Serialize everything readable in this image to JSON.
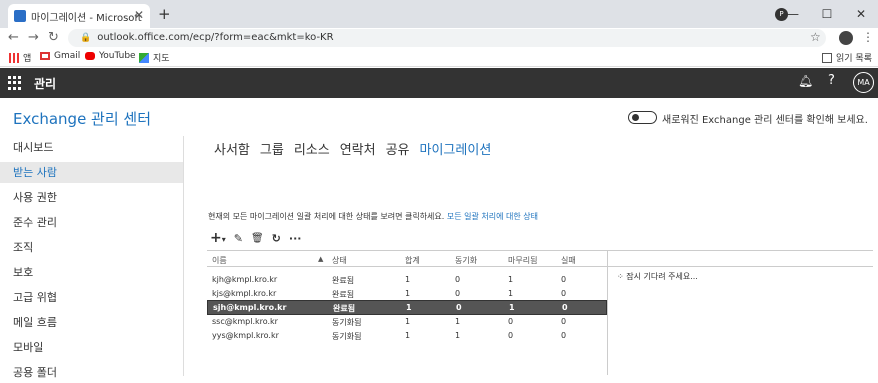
{
  "browser": {
    "tab_title": "마이그레이션 - Microsoft Exchange",
    "url": "outlook.office.com/ecp/?form=eac&mkt=ko-KR",
    "bookmarks": [
      "앱",
      "Gmail",
      "YouTube",
      "지도"
    ],
    "reading_list": "읽기 목록",
    "profile_letter": "P"
  },
  "topbar": {
    "app_name": "관리",
    "help": "?",
    "avatar": "MA"
  },
  "header": {
    "title": "Exchange 관리 센터",
    "toggle_text": "새로워진 Exchange 관리 센터를 확인해 보세요."
  },
  "sidebar": {
    "items": [
      {
        "label": "대시보드"
      },
      {
        "label": "받는 사람",
        "selected": true
      },
      {
        "label": "사용 권한"
      },
      {
        "label": "준수 관리"
      },
      {
        "label": "조직"
      },
      {
        "label": "보호"
      },
      {
        "label": "고급 위협"
      },
      {
        "label": "메일 흐름"
      },
      {
        "label": "모바일"
      },
      {
        "label": "공용 폴더"
      }
    ]
  },
  "tabs": [
    {
      "label": "사서함"
    },
    {
      "label": "그룹"
    },
    {
      "label": "리소스"
    },
    {
      "label": "연락처"
    },
    {
      "label": "공유"
    },
    {
      "label": "마이그레이션",
      "active": true
    }
  ],
  "info": {
    "text": "현재의 모든 마이그레이션 일괄 처리에 대한 상태를 보려면 클릭하세요.",
    "link": "모든 일괄 처리에 대한 상태"
  },
  "toolbar": {
    "add": "+",
    "add_caret": "▾",
    "edit": "✎",
    "delete": "🗑",
    "refresh": "↻",
    "more": "···"
  },
  "table": {
    "headers": [
      "이름",
      "상태",
      "합계",
      "동기화",
      "마무리됨",
      "실패"
    ],
    "rows": [
      [
        "kjh@kmpl.kro.kr",
        "완료됨",
        "1",
        "0",
        "1",
        "0"
      ],
      [
        "kjs@kmpl.kro.kr",
        "완료됨",
        "1",
        "0",
        "1",
        "0"
      ],
      [
        "sjh@kmpl.kro.kr",
        "완료됨",
        "1",
        "0",
        "1",
        "0"
      ],
      [
        "ssc@kmpl.kro.kr",
        "동기화됨",
        "1",
        "1",
        "0",
        "0"
      ],
      [
        "yys@kmpl.kro.kr",
        "동기화됨",
        "1",
        "1",
        "0",
        "0"
      ]
    ],
    "selected_row": 2
  },
  "detail": {
    "loading_text": "잠시 기다려 주세요..."
  }
}
